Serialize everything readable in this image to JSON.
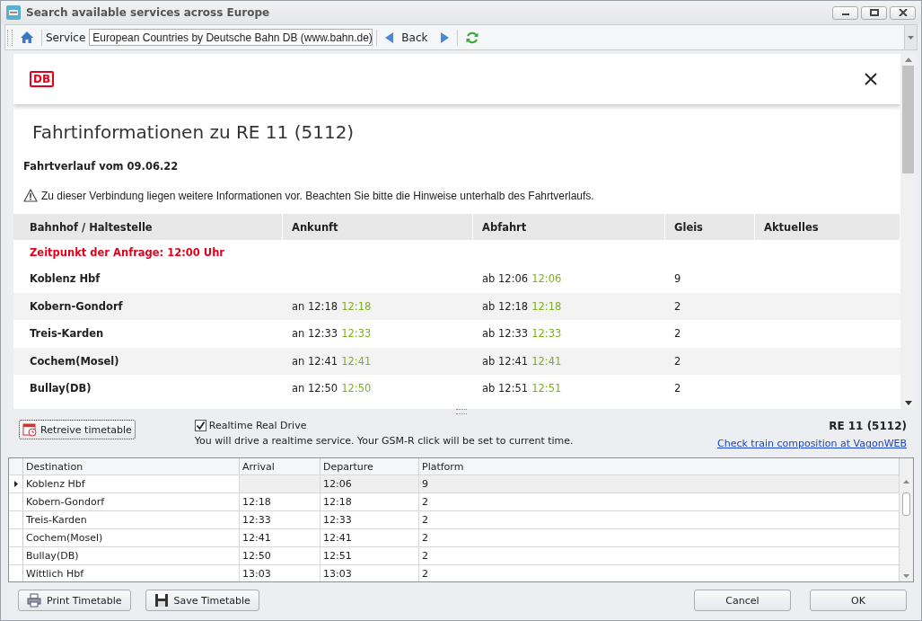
{
  "window": {
    "title": "Search available services across Europe"
  },
  "toolbar": {
    "service_label": "Service",
    "service_value": "European Countries by Deutsche Bahn DB (www.bahn.de)",
    "back_label": "Back"
  },
  "web": {
    "logo": "DB",
    "heading": "Fahrtinformationen zu RE 11 (5112)",
    "date_line": "Fahrtverlauf vom 09.06.22",
    "notice": "Zu dieser Verbindung liegen weitere Informationen vor. Beachten Sie bitte die Hinweise unterhalb des Fahrtverlaufs.",
    "columns": [
      "Bahnhof / Haltestelle",
      "Ankunft",
      "Abfahrt",
      "Gleis",
      "Aktuelles"
    ],
    "request_time": "Zeitpunkt der Anfrage: 12:00 Uhr",
    "rows": [
      {
        "station": "Koblenz Hbf",
        "arrival": "",
        "arrival_actual": "",
        "departure": "ab 12:06",
        "departure_actual": "12:06",
        "platform": "9"
      },
      {
        "station": "Kobern-Gondorf",
        "arrival": "an 12:18",
        "arrival_actual": "12:18",
        "departure": "ab 12:18",
        "departure_actual": "12:18",
        "platform": "2"
      },
      {
        "station": "Treis-Karden",
        "arrival": "an 12:33",
        "arrival_actual": "12:33",
        "departure": "ab 12:33",
        "departure_actual": "12:33",
        "platform": "2"
      },
      {
        "station": "Cochem(Mosel)",
        "arrival": "an 12:41",
        "arrival_actual": "12:41",
        "departure": "ab 12:41",
        "departure_actual": "12:41",
        "platform": "2"
      },
      {
        "station": "Bullay(DB)",
        "arrival": "an 12:50",
        "arrival_actual": "12:50",
        "departure": "ab 12:51",
        "departure_actual": "12:51",
        "platform": "2"
      }
    ]
  },
  "options": {
    "retrieve_label": "Retreive timetable",
    "realtime": {
      "label": "Realtime Real Drive",
      "checked": true
    },
    "realtime_note": "You will drive a realtime service. Your GSM-R click will be set to current time.",
    "train": "RE 11 (5112)",
    "composition_link": "Check train composition at VagonWEB"
  },
  "grid": {
    "columns": [
      "Destination",
      "Arrival",
      "Departure",
      "Platform"
    ],
    "rows": [
      {
        "cells": [
          "Koblenz Hbf",
          "",
          "12:06",
          "9"
        ],
        "selected": true
      },
      {
        "cells": [
          "Kobern-Gondorf",
          "12:18",
          "12:18",
          "2"
        ],
        "selected": false
      },
      {
        "cells": [
          "Treis-Karden",
          "12:33",
          "12:33",
          "2"
        ],
        "selected": false
      },
      {
        "cells": [
          "Cochem(Mosel)",
          "12:41",
          "12:41",
          "2"
        ],
        "selected": false
      },
      {
        "cells": [
          "Bullay(DB)",
          "12:50",
          "12:51",
          "2"
        ],
        "selected": false
      },
      {
        "cells": [
          "Wittlich Hbf",
          "13:03",
          "13:03",
          "2"
        ],
        "selected": false
      }
    ]
  },
  "buttons": {
    "print": "Print Timetable",
    "save": "Save Timetable",
    "cancel": "Cancel",
    "ok": "OK"
  }
}
